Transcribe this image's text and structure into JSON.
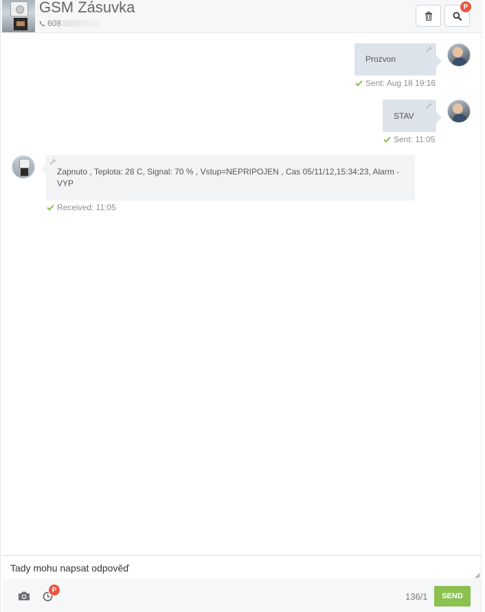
{
  "header": {
    "contact_name": "GSM Zásuvka",
    "contact_phone": "608",
    "search_badge": "P"
  },
  "messages": [
    {
      "direction": "out",
      "text": "Prozvon",
      "status_label": "Sent: Aug 18 19:16"
    },
    {
      "direction": "out",
      "text": "STAV",
      "status_label": "Sent: 11:05"
    },
    {
      "direction": "in",
      "text": "Zapnuto , Teplota: 28 C, Signal: 70 % , Vstup=NEPRIPOJEN , Cas 05/11/12,15:34:23, Alarm - VYP",
      "status_label": "Received: 11:05"
    }
  ],
  "composer": {
    "value": "Tady mohu napsat odpověď",
    "char_counter": "136/1",
    "send_label": "SEND",
    "schedule_badge": "P"
  },
  "colors": {
    "send_button": "#8cc152",
    "badge": "#e9573f",
    "check": "#8cc152",
    "outgoing_bubble": "#dde3ea",
    "incoming_bubble": "#f2f3f5"
  },
  "icons": [
    "trash-icon",
    "search-icon",
    "phone-icon",
    "wrench-icon",
    "check-icon",
    "camera-icon",
    "clock-icon"
  ]
}
